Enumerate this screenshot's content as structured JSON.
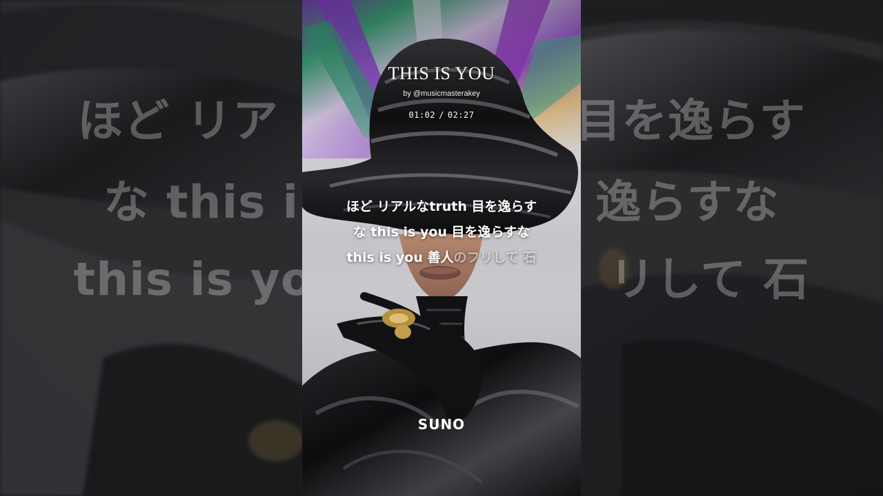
{
  "song": {
    "title": "THIS IS YOU",
    "artist": "by @musicmasterakey",
    "current_time": "01:02",
    "separator": "/",
    "duration": "02:27"
  },
  "lyrics": {
    "line1": "ほど リアルなtruth 目を逸らす",
    "line2": "な this is you 目を逸らすな",
    "line3_sung": "this is you 善人",
    "line3_upcoming": "のフリして 石"
  },
  "background_lyrics": {
    "line1_left": "ほど リア",
    "line1_right": "目を逸らす",
    "line2_left": "な this i",
    "line2_right": "逸らすな",
    "line3_left": "this is yo",
    "line3_right": "リして 石"
  },
  "brand": {
    "logo_text": "SUNO"
  },
  "colors": {
    "text": "#ffffff",
    "background": "#2a2a2c"
  }
}
